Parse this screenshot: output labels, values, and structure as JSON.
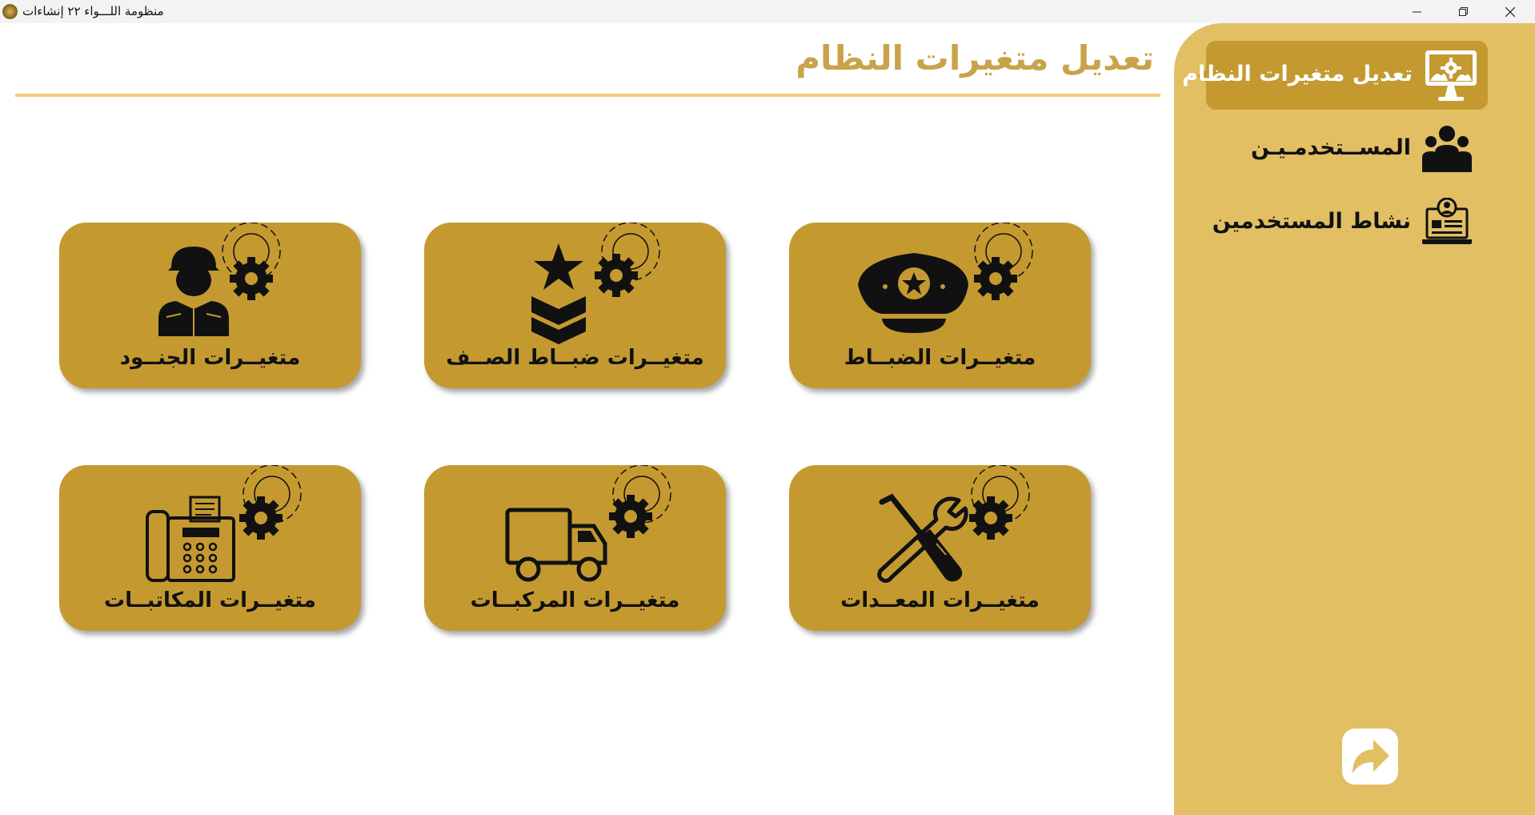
{
  "window": {
    "title": "منظومة اللـــواء ٢٢ إنشاءات"
  },
  "colors": {
    "sidebar": "#e2bf63",
    "accent": "#c49a30",
    "title": "#c9a24a",
    "rule": "#f0cc73"
  },
  "header": {
    "title": "تعديل متغيرات النظام"
  },
  "sidebar": {
    "items": [
      {
        "label": "تعديل متغيرات النظام",
        "icon": "monitor-settings-icon",
        "active": true
      },
      {
        "label": "المســتخدمـيـن",
        "icon": "users-group-icon",
        "active": false
      },
      {
        "label": "نشاط المستخدمين",
        "icon": "user-activity-laptop-icon",
        "active": false
      }
    ],
    "back_icon": "forward-arrow-icon"
  },
  "cards": [
    {
      "label": "متغيــرات الجنــود",
      "icon": "soldier-settings-icon"
    },
    {
      "label": "متغيــرات ضبــاط الصــف",
      "icon": "nco-rank-settings-icon"
    },
    {
      "label": "متغيــرات الضبــاط",
      "icon": "officer-cap-settings-icon"
    },
    {
      "label": "متغيــرات المكاتبــات",
      "icon": "fax-settings-icon"
    },
    {
      "label": "متغيــرات المركبــات",
      "icon": "truck-settings-icon"
    },
    {
      "label": "متغيــرات المعــدات",
      "icon": "tools-settings-icon"
    }
  ]
}
